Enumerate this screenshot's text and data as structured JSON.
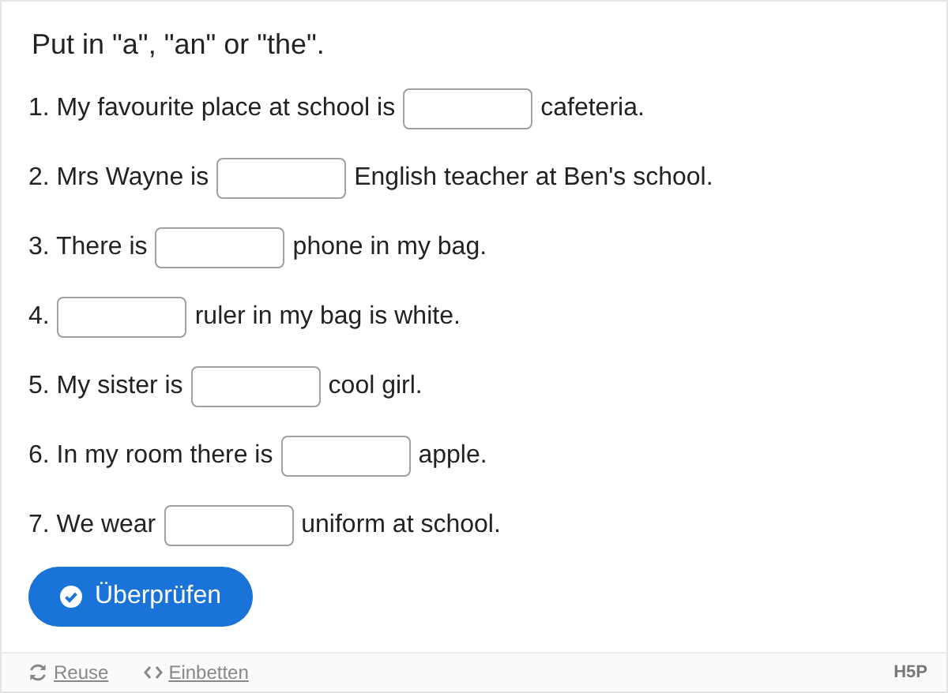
{
  "title": "Put in \"a\", \"an\" or \"the\".",
  "questions": [
    {
      "before": "1. My favourite place at school is",
      "after": "cafeteria."
    },
    {
      "before": "2. Mrs Wayne is",
      "after": "English teacher at Ben's school."
    },
    {
      "before": "3. There is",
      "after": "phone in my bag."
    },
    {
      "before": "4.",
      "after": "ruler in my bag is white."
    },
    {
      "before": "5. My sister is",
      "after": "cool girl."
    },
    {
      "before": "6. In my room there is",
      "after": "apple."
    },
    {
      "before": "7. We wear",
      "after": "uniform at school."
    }
  ],
  "check_button": "Überprüfen",
  "footer": {
    "links": [
      {
        "kind": "reuse",
        "label": "Reuse"
      },
      {
        "kind": "embed",
        "label": "Einbetten"
      }
    ],
    "logo": "H5P"
  }
}
